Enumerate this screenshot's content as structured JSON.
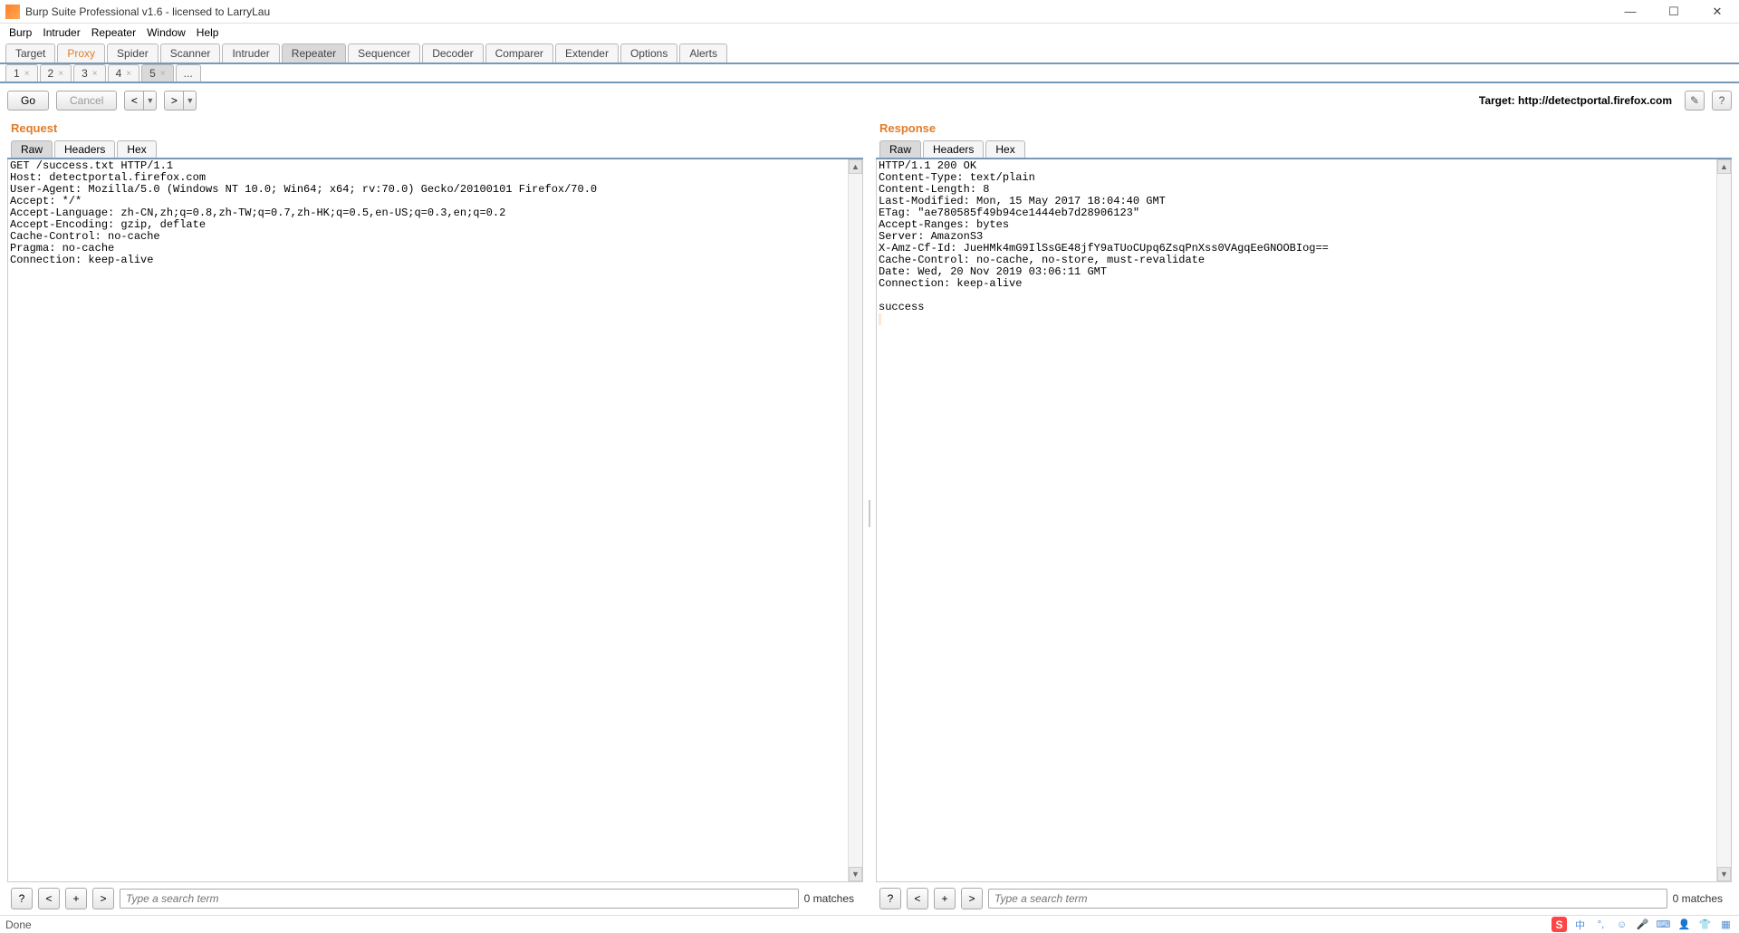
{
  "window": {
    "title": "Burp Suite Professional v1.6 - licensed to LarryLau"
  },
  "menu": {
    "items": [
      "Burp",
      "Intruder",
      "Repeater",
      "Window",
      "Help"
    ]
  },
  "tool_tabs": [
    "Target",
    "Proxy",
    "Spider",
    "Scanner",
    "Intruder",
    "Repeater",
    "Sequencer",
    "Decoder",
    "Comparer",
    "Extender",
    "Options",
    "Alerts"
  ],
  "tool_tabs_active": "Repeater",
  "repeater_tabs": [
    "1",
    "2",
    "3",
    "4",
    "5",
    "..."
  ],
  "repeater_tabs_active": "5",
  "actions": {
    "go": "Go",
    "cancel": "Cancel"
  },
  "target_label": "Target: http://detectportal.firefox.com",
  "panes": {
    "request": {
      "title": "Request",
      "tabs": [
        "Raw",
        "Headers",
        "Hex"
      ],
      "active": "Raw",
      "raw": "GET /success.txt HTTP/1.1\nHost: detectportal.firefox.com\nUser-Agent: Mozilla/5.0 (Windows NT 10.0; Win64; x64; rv:70.0) Gecko/20100101 Firefox/70.0\nAccept: */*\nAccept-Language: zh-CN,zh;q=0.8,zh-TW;q=0.7,zh-HK;q=0.5,en-US;q=0.3,en;q=0.2\nAccept-Encoding: gzip, deflate\nCache-Control: no-cache\nPragma: no-cache\nConnection: keep-alive\n"
    },
    "response": {
      "title": "Response",
      "tabs": [
        "Raw",
        "Headers",
        "Hex"
      ],
      "active": "Raw",
      "raw": "HTTP/1.1 200 OK\nContent-Type: text/plain\nContent-Length: 8\nLast-Modified: Mon, 15 May 2017 18:04:40 GMT\nETag: \"ae780585f49b94ce1444eb7d28906123\"\nAccept-Ranges: bytes\nServer: AmazonS3\nX-Amz-Cf-Id: JueHMk4mG9IlSsGE48jfY9aTUoCUpq6ZsqPnXss0VAgqEeGNOOBIog==\nCache-Control: no-cache, no-store, must-revalidate\nDate: Wed, 20 Nov 2019 03:06:11 GMT\nConnection: keep-alive\n\nsuccess\n"
    }
  },
  "search": {
    "placeholder": "Type a search term",
    "matches": "0 matches"
  },
  "status": {
    "text": "Done"
  },
  "tray": {
    "ime": "中"
  }
}
